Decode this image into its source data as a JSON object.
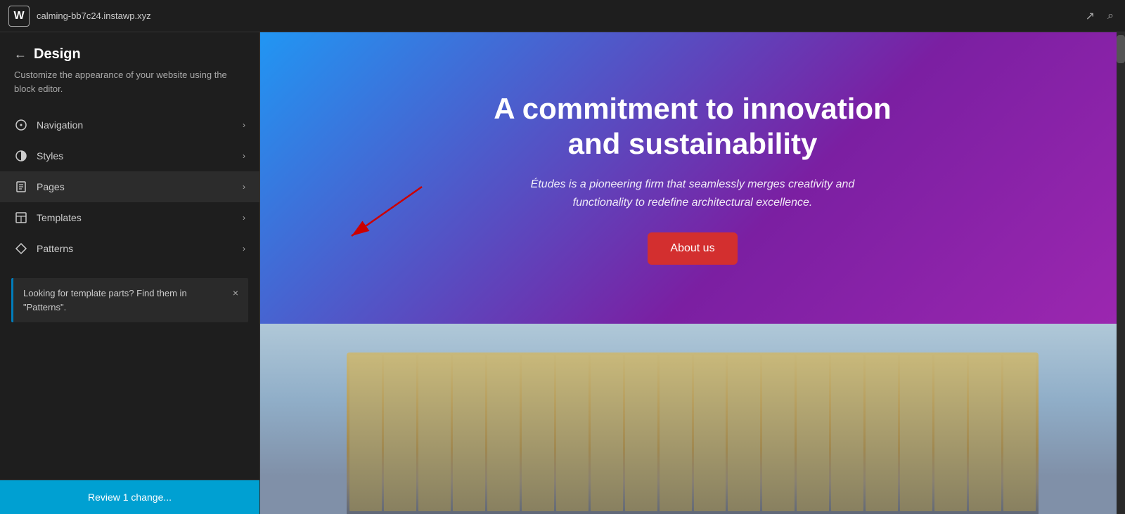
{
  "topbar": {
    "logo_symbol": "W",
    "site_url": "calming-bb7c24.instawp.xyz",
    "external_link_icon": "↗",
    "search_icon": "🔍"
  },
  "sidebar": {
    "back_label": "←",
    "title": "Design",
    "description": "Customize the appearance of your website using the block editor.",
    "menu_items": [
      {
        "id": "navigation",
        "label": "Navigation",
        "icon": "○"
      },
      {
        "id": "styles",
        "label": "Styles",
        "icon": "◑"
      },
      {
        "id": "pages",
        "label": "Pages",
        "icon": "☰"
      },
      {
        "id": "templates",
        "label": "Templates",
        "icon": "⊞"
      },
      {
        "id": "patterns",
        "label": "Patterns",
        "icon": "◇"
      }
    ],
    "notification": {
      "text": "Looking for template parts? Find them in \"Patterns\".",
      "close_icon": "×"
    },
    "review_button_label": "Review 1 change..."
  },
  "preview": {
    "hero": {
      "title": "A commitment to innovation and sustainability",
      "subtitle": "Études is a pioneering firm that seamlessly merges creativity and functionality to redefine architectural excellence.",
      "button_label": "About us"
    }
  },
  "colors": {
    "sidebar_bg": "#1e1e1e",
    "active_item_bg": "#2c2c2c",
    "review_button_bg": "#00a0d2",
    "hero_gradient_start": "#2196F3",
    "hero_gradient_end": "#9C27B0",
    "about_button_bg": "#d32f2f",
    "notification_border": "#007cba"
  }
}
